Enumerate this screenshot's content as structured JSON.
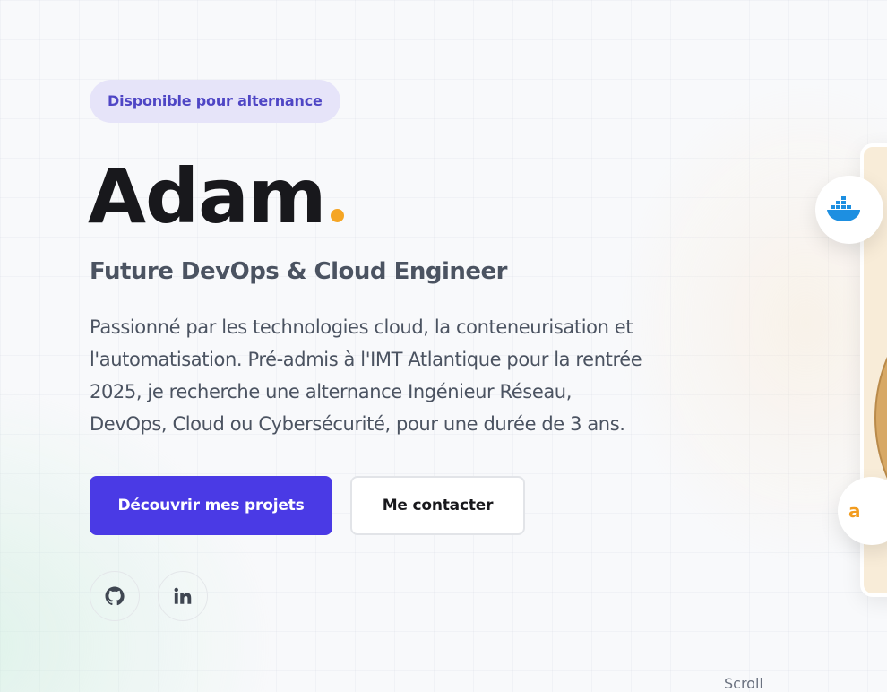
{
  "hero": {
    "badge": "Disponible pour alternance",
    "name": "Adam",
    "subtitle": "Future DevOps & Cloud Engineer",
    "description": "Passionné par les technologies cloud, la conteneurisation et l'automatisation. Pré-admis à l'IMT Atlantique pour la rentrée 2025, je recherche une alternance Ingénieur Réseau, DevOps, Cloud ou Cybersécurité, pour une durée de 3 ans.",
    "primary_button": "Découvrir mes projets",
    "secondary_button": "Me contacter",
    "socials": [
      {
        "icon": "github-icon",
        "label": "GitHub"
      },
      {
        "icon": "linkedin-icon",
        "label": "LinkedIn"
      }
    ]
  },
  "scroll_label": "Scroll",
  "floating_badges": [
    {
      "icon": "docker-icon"
    },
    {
      "icon": "aws-icon",
      "text": "a"
    }
  ],
  "colors": {
    "accent": "#4a3ae5",
    "badge_bg": "#e6e4f9",
    "badge_text": "#4f46c5",
    "dot": "#f5a524",
    "docker": "#1d8fe1",
    "aws": "#f29c1f"
  }
}
